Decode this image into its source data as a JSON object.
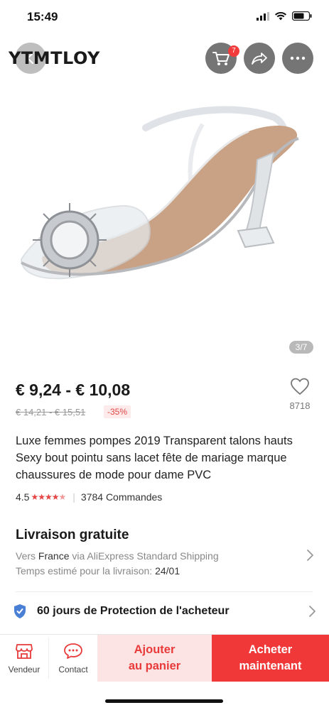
{
  "status_bar": {
    "time": "15:49"
  },
  "header": {
    "brand": "YTMTLOY",
    "cart_badge": "7"
  },
  "gallery": {
    "counter": "3/7"
  },
  "price": {
    "range": "€ 9,24 - € 10,08",
    "original": "€ 14,21 - € 15,51",
    "discount": "-35%"
  },
  "wishlist": {
    "count": "8718"
  },
  "product": {
    "title": "Luxe femmes pompes 2019 Transparent talons hauts Sexy bout pointu sans lacet fête de mariage marque chaussures de mode pour dame PVC",
    "rating": "4.5",
    "orders": "3784 Commandes"
  },
  "shipping": {
    "title": "Livraison gratuite",
    "to_prefix": "Vers",
    "country": "France",
    "via": "via AliExpress Standard Shipping",
    "eta_label": "Temps estimé pour la livraison:",
    "eta_date": "24/01"
  },
  "protection": {
    "label": "60 jours de Protection de l'acheteur"
  },
  "bottom_bar": {
    "vendor": "Vendeur",
    "contact": "Contact",
    "add_cart_line1": "Ajouter",
    "add_cart_line2": "au panier",
    "buy_line1": "Acheter",
    "buy_line2": "maintenant"
  },
  "colors": {
    "accent_red": "#f03838",
    "light_red": "#fde4e4",
    "star_red": "#e64545",
    "text_dark": "#1a1a1a",
    "text_muted": "#888888"
  },
  "icons": [
    "back-arrow-icon",
    "cart-icon",
    "share-icon",
    "more-icon",
    "heart-icon",
    "shield-icon",
    "chevron-right-icon",
    "store-icon",
    "chat-icon"
  ]
}
